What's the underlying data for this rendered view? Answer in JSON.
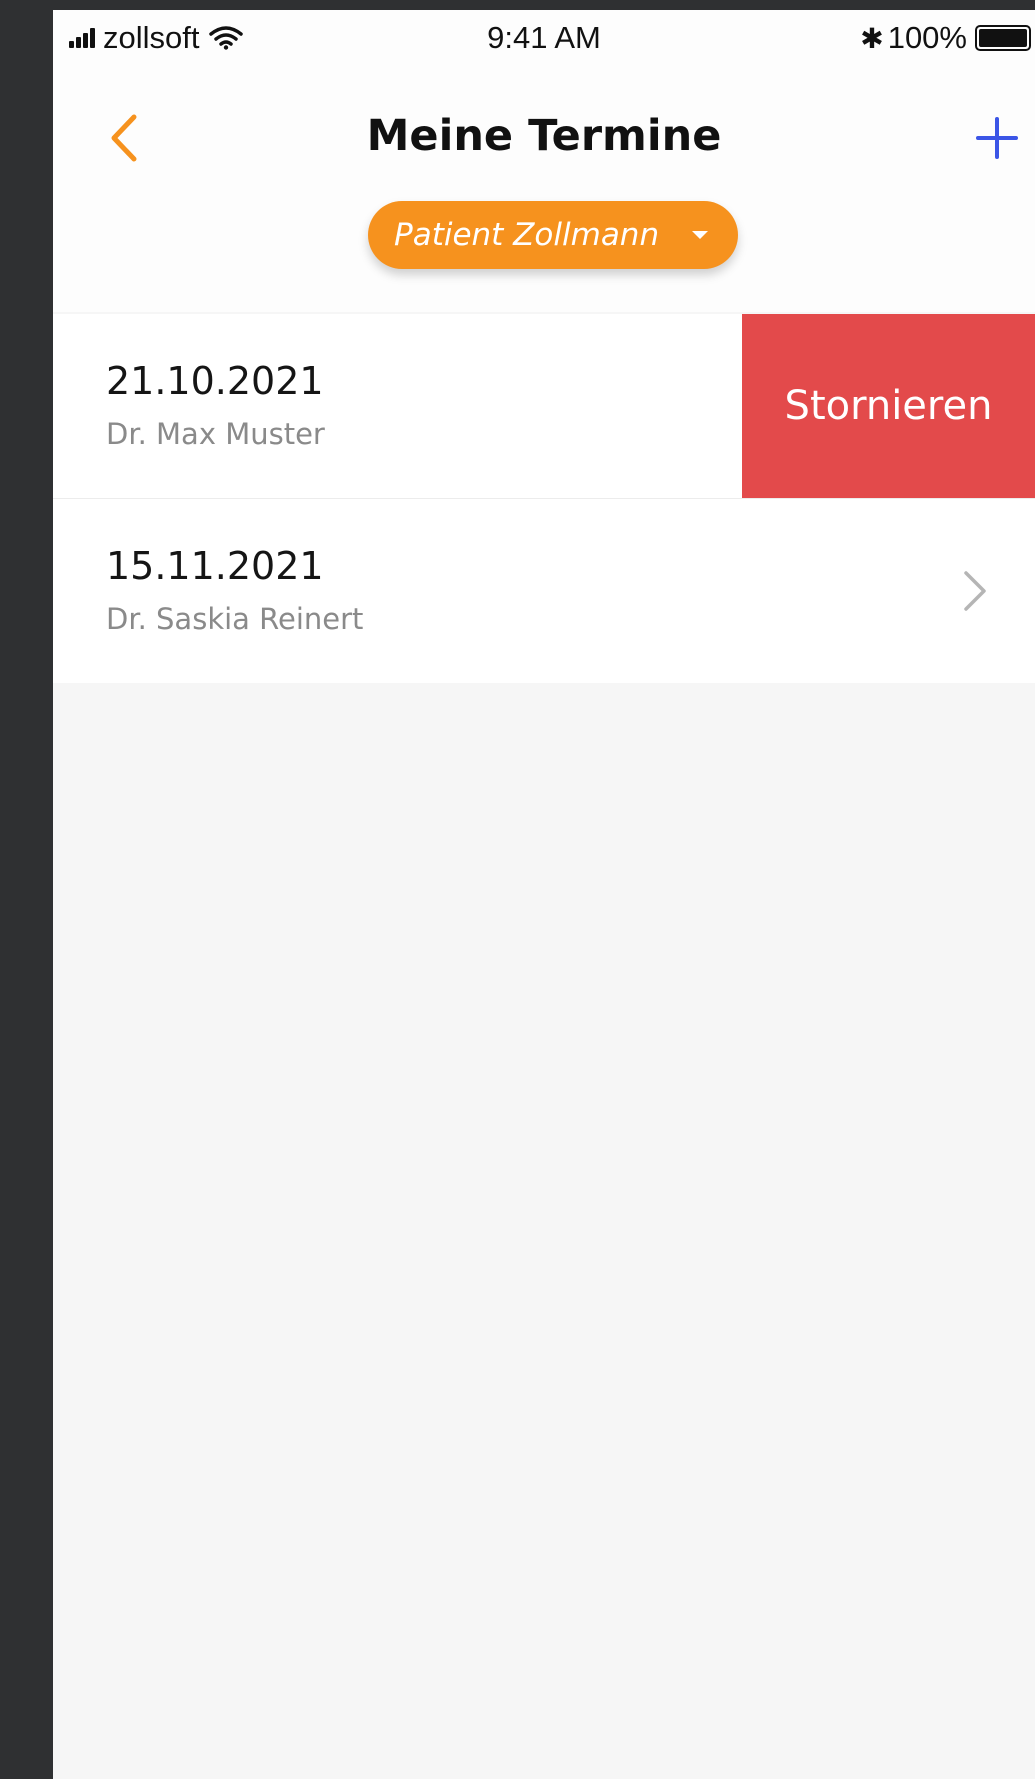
{
  "status_bar": {
    "carrier": "zollsoft",
    "time": "9:41 AM",
    "battery": "100%"
  },
  "nav": {
    "title": "Meine Termine",
    "patient_selector": "Patient Zollmann"
  },
  "appointments": [
    {
      "date": "21.10.2021",
      "doctor": "Dr. Max Muster",
      "swipe_action": "Stornieren"
    },
    {
      "date": "15.11.2021",
      "doctor": "Dr. Saskia Reinert"
    }
  ],
  "colors": {
    "accent": "#f6921e",
    "add": "#3b55e6",
    "delete": "#e34a4b"
  }
}
